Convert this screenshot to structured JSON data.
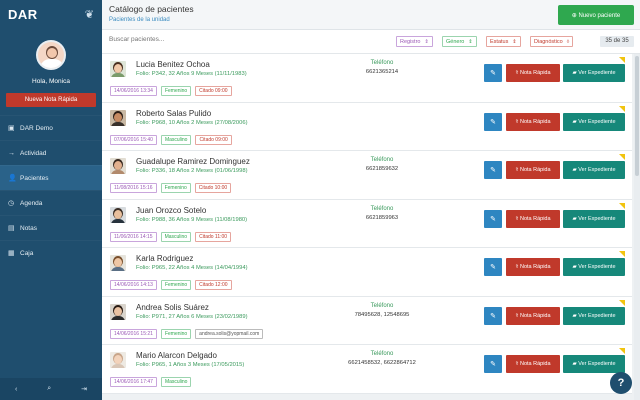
{
  "app": {
    "logo": "DAR",
    "greeting": "Hola, Monica",
    "quick_note_label": "Nueva Nota Rápida"
  },
  "nav": [
    {
      "label": "DAR Demo",
      "icon": "square-icon",
      "glyph": "▣",
      "active": false
    },
    {
      "label": "Actividad",
      "icon": "arrow-right-icon",
      "glyph": "→",
      "active": false
    },
    {
      "label": "Pacientes",
      "icon": "users-icon",
      "glyph": "👤",
      "active": true
    },
    {
      "label": "Agenda",
      "icon": "clock-icon",
      "glyph": "◷",
      "active": false
    },
    {
      "label": "Notas",
      "icon": "book-icon",
      "glyph": "▤",
      "active": false
    },
    {
      "label": "Caja",
      "icon": "cash-icon",
      "glyph": "▦",
      "active": false
    }
  ],
  "header": {
    "title": "Catálogo de pacientes",
    "subtitle": "Pacientes de la unidad",
    "new_patient_label": "Nuevo paciente"
  },
  "filters": {
    "search_placeholder": "Buscar pacientes...",
    "registro": "Registro",
    "genero": "Género",
    "estatus": "Estatus",
    "diagnostico": "Diagnóstico",
    "count": "35 de 35"
  },
  "colors": {
    "sidebar": "#1f4e6e",
    "edit": "#2e86c1",
    "nota": "#c0392b",
    "expediente": "#16887a",
    "new_patient": "#2fa84f"
  },
  "row_buttons": {
    "nota_label": "Nota Rápida",
    "exp_label": "Ver Expediente"
  },
  "patients": [
    {
      "name": "Lucia Benitez Ochoa",
      "folio": "Folio: P342, 32 Años 9 Meses (11/11/1983)",
      "tel_label": "Teléfono",
      "tel": "6621365214",
      "date": "14/06/2016 13:34",
      "gender": "Femenino",
      "tag3": "Citado 09:00",
      "tag3_type": "cit"
    },
    {
      "name": "Roberto Salas Pulido",
      "folio": "Folio: P968, 10 Años 2 Meses (27/08/2006)",
      "tel_label": "",
      "tel": "",
      "date": "07/06/2016 15:40",
      "gender": "Masculino",
      "tag3": "Citado 09:00",
      "tag3_type": "cit"
    },
    {
      "name": "Guadalupe Ramirez Dominguez",
      "folio": "Folio: P336, 18 Años 2 Meses (01/06/1998)",
      "tel_label": "Teléfono",
      "tel": "6621859632",
      "date": "11/08/2016 15:16",
      "gender": "Femenino",
      "tag3": "Citado 10:00",
      "tag3_type": "cit"
    },
    {
      "name": "Juan Orozco Sotelo",
      "folio": "Folio: P988, 36 Años 9 Meses (11/08/1980)",
      "tel_label": "Teléfono",
      "tel": "6621859963",
      "date": "11/06/2016 14:15",
      "gender": "Masculino",
      "tag3": "Citado 11:00",
      "tag3_type": "cit"
    },
    {
      "name": "Karla Rodriguez",
      "folio": "Folio: P965, 22 Años 4 Meses (14/04/1994)",
      "tel_label": "",
      "tel": "",
      "date": "14/06/2016 14:13",
      "gender": "Femenino",
      "tag3": "Citado 12:00",
      "tag3_type": "cit"
    },
    {
      "name": "Andrea Solis Suárez",
      "folio": "Folio: P971, 27 Años 6 Meses (23/02/1989)",
      "tel_label": "Teléfono",
      "tel": "78495628, 12548695",
      "date": "14/06/2016 15:21",
      "gender": "Femenino",
      "tag3": "andrea.solis@yopmail.com",
      "tag3_type": "mail"
    },
    {
      "name": "Mario Alarcon Delgado",
      "folio": "Folio: P965, 1 Años 3 Meses (17/05/2015)",
      "tel_label": "Teléfono",
      "tel": "6621458532, 6622864712",
      "date": "14/06/2016 17:47",
      "gender": "Masculino",
      "tag3": "",
      "tag3_type": ""
    }
  ]
}
